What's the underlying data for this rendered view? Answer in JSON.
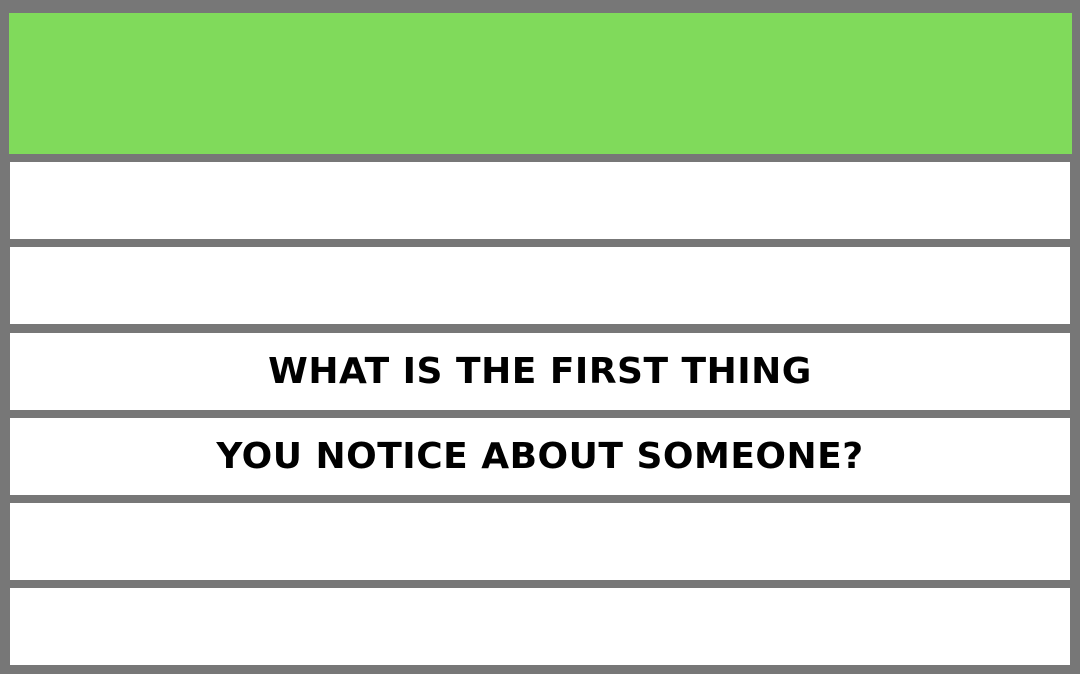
{
  "card": {
    "header_color": "#80da5b",
    "border_color": "#777777",
    "row_color": "#ffffff"
  },
  "question": {
    "line_1": "WHAT IS THE FIRST THING",
    "line_2": "YOU NOTICE ABOUT SOMEONE?"
  }
}
